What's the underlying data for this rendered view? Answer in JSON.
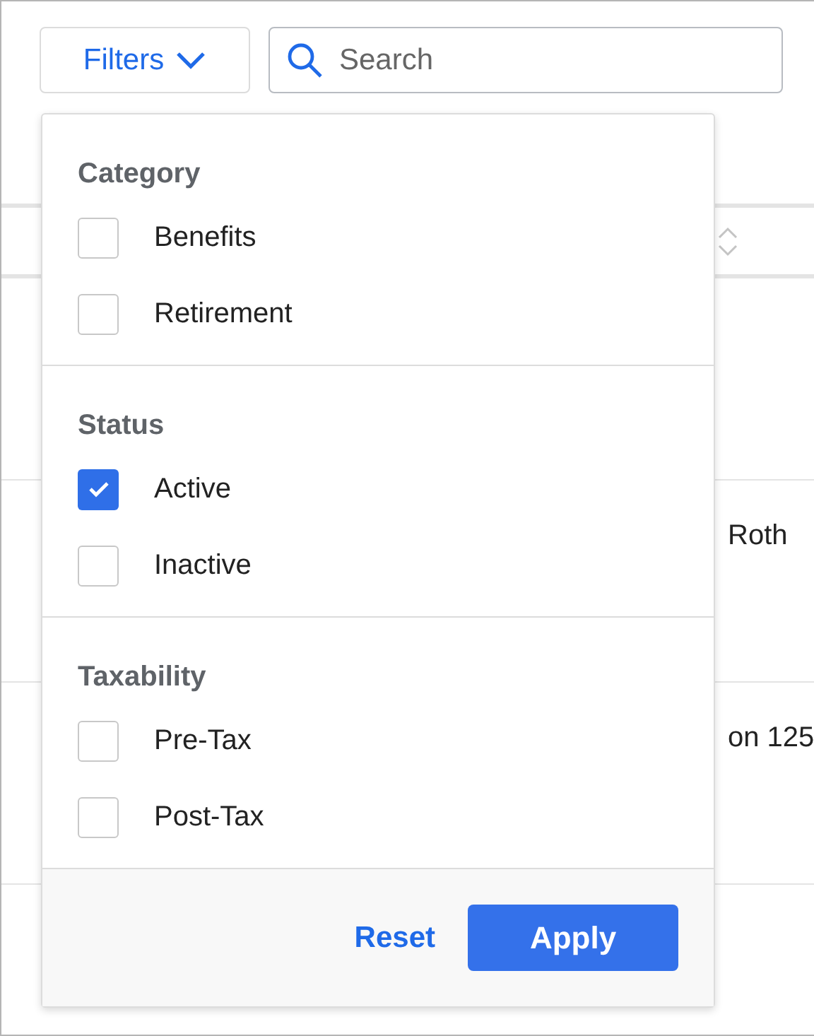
{
  "toolbar": {
    "filters_button": "Filters",
    "search": {
      "placeholder": "Search"
    }
  },
  "table": {
    "rows": [
      {
        "text": ""
      },
      {
        "text": "Roth"
      },
      {
        "text": "on 125"
      }
    ]
  },
  "filters_menu": {
    "sections": [
      {
        "title": "Category",
        "options": [
          {
            "label": "Benefits",
            "checked": false
          },
          {
            "label": "Retirement",
            "checked": false
          }
        ]
      },
      {
        "title": "Status",
        "options": [
          {
            "label": "Active",
            "checked": true
          },
          {
            "label": "Inactive",
            "checked": false
          }
        ]
      },
      {
        "title": "Taxability",
        "options": [
          {
            "label": "Pre-Tax",
            "checked": false
          },
          {
            "label": "Post-Tax",
            "checked": false
          }
        ]
      }
    ],
    "reset": "Reset",
    "apply": "Apply"
  }
}
